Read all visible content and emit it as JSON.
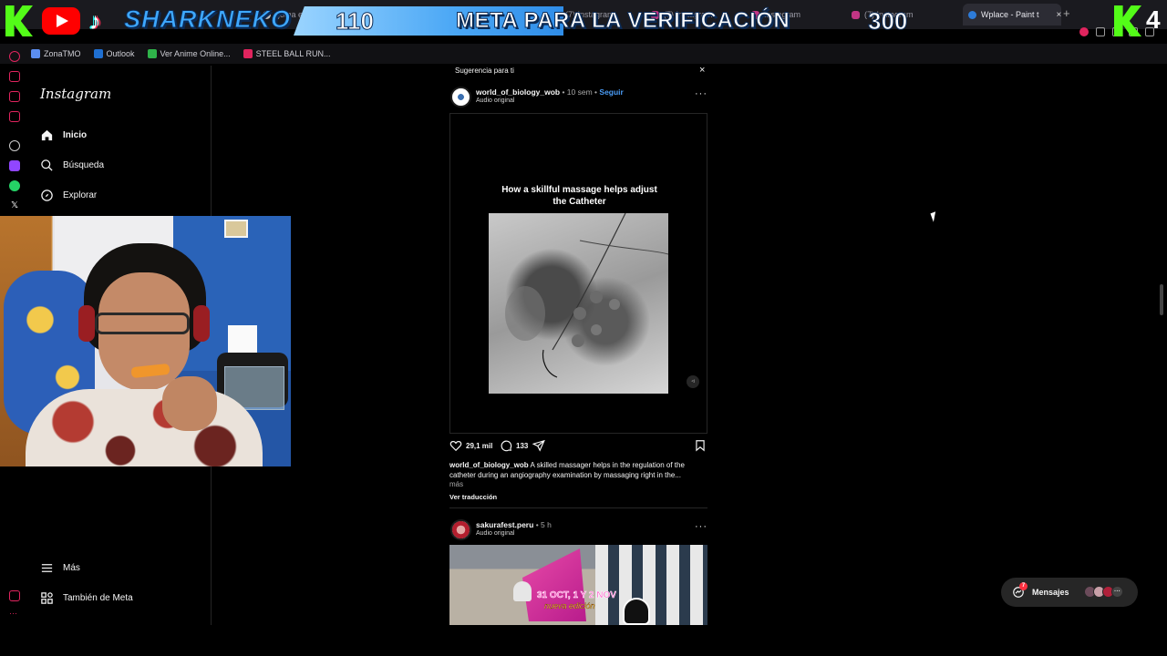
{
  "browser": {
    "tabs": [
      {
        "label": "goma eva - B"
      },
      {
        "label": "(7) Instagram"
      },
      {
        "label": "(7) Instagram"
      },
      {
        "label": "Instagram"
      },
      {
        "label": "(7) Instagram"
      },
      {
        "label": "Wplace - Paint t",
        "active": true
      }
    ],
    "new_tab": "+",
    "tab_close": "×",
    "bookmarks": [
      {
        "label": "ZonaTMO",
        "color": "#5b8def"
      },
      {
        "label": "Outlook",
        "color": "#1f6fd1"
      },
      {
        "label": "Ver Anime Online...",
        "color": "#2fb34a"
      },
      {
        "label": "STEEL BALL RUN...",
        "color": "#e0245e"
      }
    ]
  },
  "overlay": {
    "brand": "SHARKNEKO",
    "count_left": "110",
    "goal": "META PARA LA VERIFICACIÓN",
    "count_right": "300",
    "digit_right": "4",
    "colors": {
      "kick": "#53fc18",
      "youtube": "#ff0000",
      "brand_blue": "#3ea8ff"
    }
  },
  "instagram": {
    "logo": "Instagram",
    "nav": [
      {
        "label": "Inicio",
        "icon": "home-icon",
        "bold": true
      },
      {
        "label": "Búsqueda",
        "icon": "search-icon"
      },
      {
        "label": "Explorar",
        "icon": "compass-icon"
      }
    ],
    "nav_bottom": [
      {
        "label": "Más",
        "icon": "menu-icon"
      },
      {
        "label": "También de Meta",
        "icon": "meta-grid-icon"
      }
    ]
  },
  "feed": {
    "suggestion_label": "Sugerencia para ti",
    "close": "×",
    "post1": {
      "username": "world_of_biology_wob",
      "time": "• 10 sem •",
      "follow": "Seguir",
      "audio": "Audio original",
      "more": "···",
      "media_caption_line1": "How a skillful massage helps adjust",
      "media_caption_line2": "the Catheter",
      "likes": "29,1 mil",
      "comments": "133",
      "caption_user": "world_of_biology_wob",
      "caption_text": "A skilled massager helps in the regulation of the catheter during an angiography examination by massaging right in the...",
      "caption_more": "más",
      "translate": "Ver traducción"
    },
    "post2": {
      "username": "sakurafest.peru",
      "time": "• 5 h",
      "audio": "Audio original",
      "more": "···",
      "media_title": "31 OCT, 1 Y 2 NOV",
      "media_subtitle": "nueva edición"
    }
  },
  "messages": {
    "label": "Mensajes",
    "badge": "7"
  }
}
